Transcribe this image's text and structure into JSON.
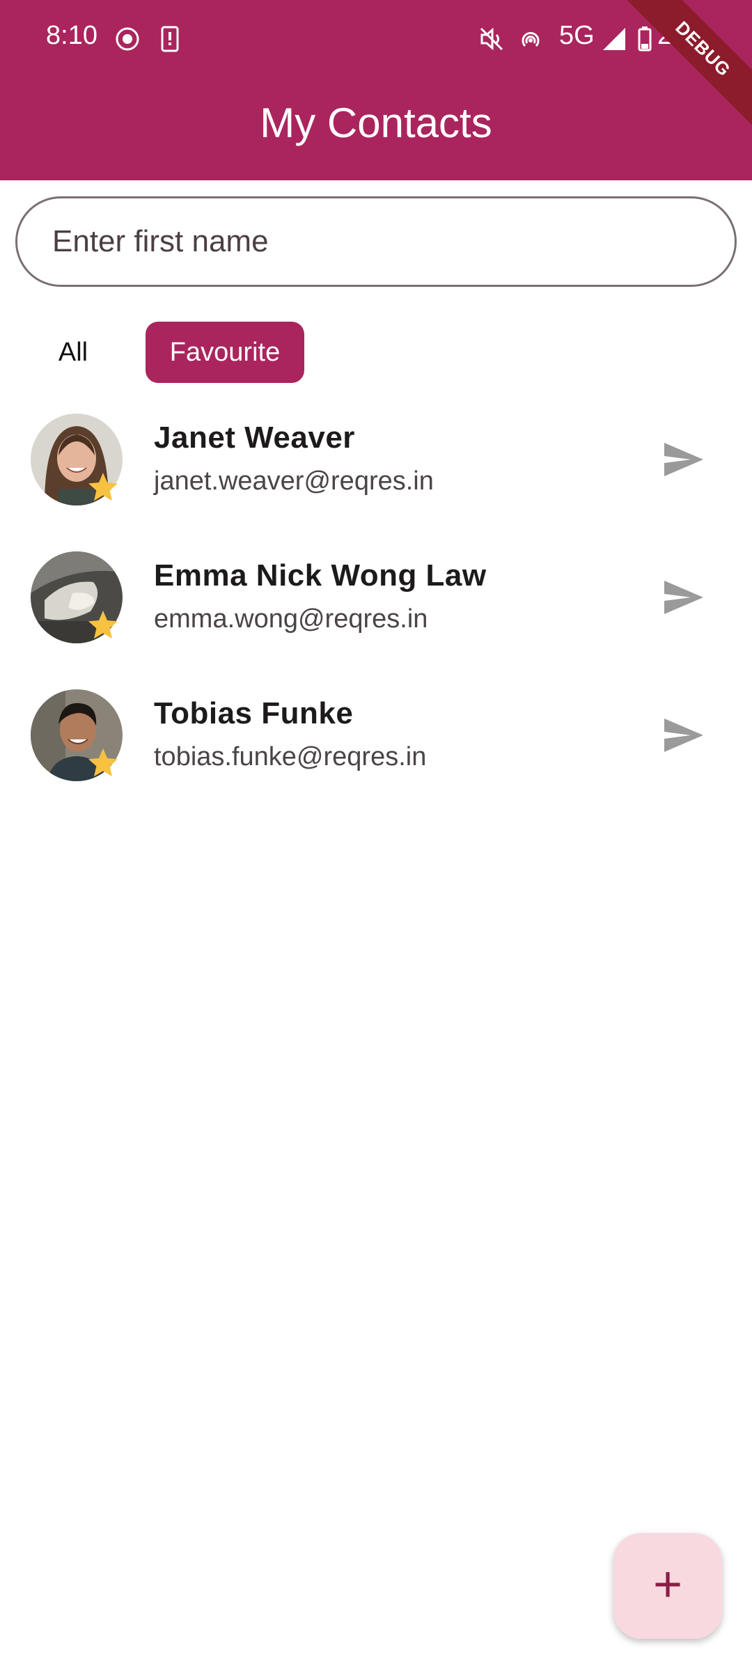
{
  "status_bar": {
    "time": "8:10",
    "network": "5G",
    "battery": "21%"
  },
  "app_bar": {
    "title": "My Contacts",
    "debug_banner": "DEBUG"
  },
  "search": {
    "placeholder": "Enter first name",
    "value": ""
  },
  "filters": {
    "all_label": "All",
    "favourite_label": "Favourite",
    "selected": "Favourite"
  },
  "contacts": [
    {
      "name": "Janet Weaver",
      "email": "janet.weaver@reqres.in",
      "favourite": true
    },
    {
      "name": "Emma Nick Wong Law",
      "email": "emma.wong@reqres.in",
      "favourite": true
    },
    {
      "name": "Tobias Funke",
      "email": "tobias.funke@reqres.in",
      "favourite": true
    }
  ],
  "fab": {
    "label": "+"
  },
  "colors": {
    "primary": "#aa255d",
    "fab_background": "#f8d9e0",
    "star": "#f7c241",
    "send_icon": "#9a9a9a"
  }
}
